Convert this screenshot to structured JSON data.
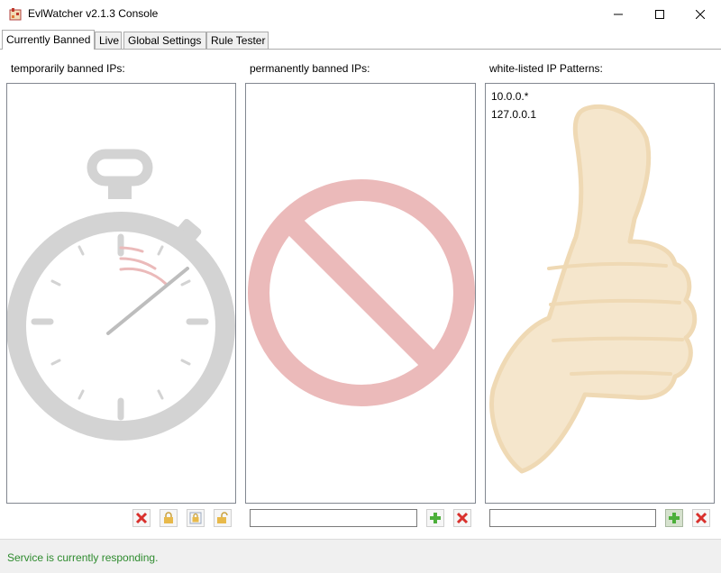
{
  "window": {
    "title": "EvlWatcher v2.1.3 Console",
    "minimize_icon": "minimize-icon",
    "maximize_icon": "maximize-icon",
    "close_icon": "close-icon"
  },
  "tabs": [
    {
      "label": "Currently Banned",
      "active": true
    },
    {
      "label": "Live",
      "active": false
    },
    {
      "label": "Global Settings",
      "active": false
    },
    {
      "label": "Rule Tester",
      "active": false
    }
  ],
  "panels": {
    "temporary": {
      "label": "temporarily banned IPs:",
      "entries": [],
      "watermark": "stopwatch-icon",
      "buttons": [
        "delete-icon",
        "lock-icon",
        "lock-permanent-icon",
        "unlock-icon"
      ]
    },
    "permanent": {
      "label": "permanently banned IPs:",
      "entries": [],
      "watermark": "prohibited-icon",
      "input_value": "",
      "buttons": [
        "add-icon",
        "delete-icon"
      ]
    },
    "whitelist": {
      "label": "white-listed IP Patterns:",
      "entries": [
        "10.0.0.*",
        "127.0.0.1"
      ],
      "watermark": "thumbs-up-icon",
      "input_value": "",
      "buttons": [
        "add-icon",
        "delete-icon"
      ]
    }
  },
  "status": {
    "text": "Service is currently responding.",
    "color": "#2e8b2e"
  },
  "colors": {
    "delete": "#d9302c",
    "add": "#4caf3a",
    "lock": "#e8b94a",
    "stopwatch": "#d3d3d3",
    "prohibited": "#ebbaba",
    "thumb": "#f5e6cc"
  }
}
